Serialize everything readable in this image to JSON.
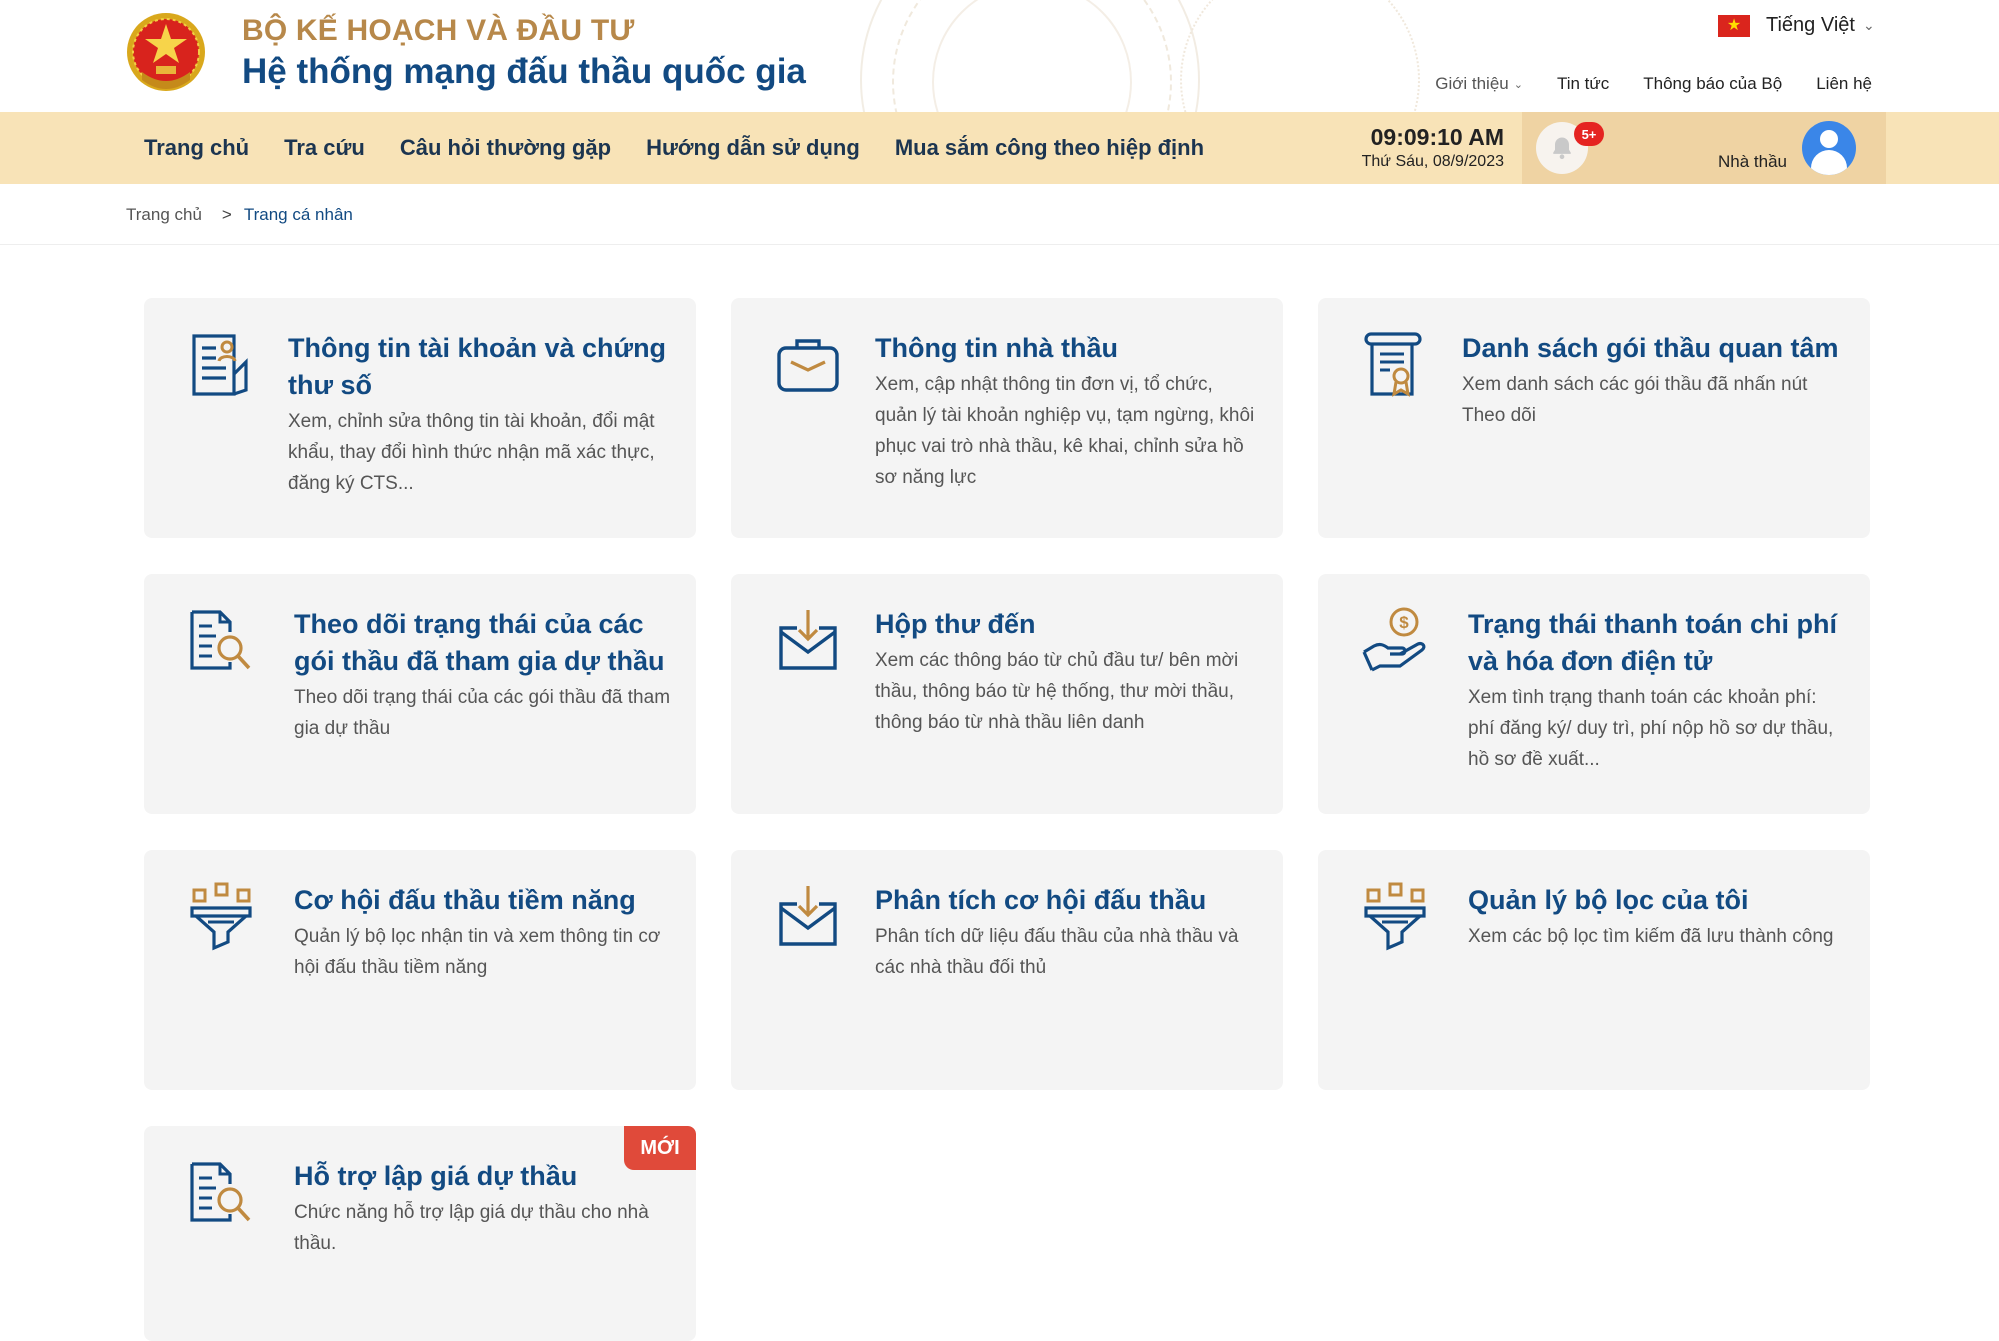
{
  "header": {
    "org_name": "BỘ KẾ HOẠCH VÀ ĐẦU TƯ",
    "system_name": "Hệ thống mạng đấu thầu quốc gia",
    "language": "Tiếng Việt",
    "top_links": [
      {
        "label": "Giới thiệu"
      },
      {
        "label": "Tin tức"
      },
      {
        "label": "Thông báo của Bộ"
      },
      {
        "label": "Liên hệ"
      }
    ]
  },
  "nav": {
    "items": [
      {
        "label": "Trang chủ"
      },
      {
        "label": "Tra cứu"
      },
      {
        "label": "Câu hỏi thường gặp"
      },
      {
        "label": "Hướng dẫn sử dụng"
      },
      {
        "label": "Mua sắm công theo hiệp định"
      }
    ],
    "time": "09:09:10 AM",
    "date": "Thứ Sáu, 08/9/2023",
    "notification_badge": "5+",
    "role": "Nhà thầu"
  },
  "breadcrumb": {
    "home": "Trang chủ",
    "separator": ">",
    "current": "Trang cá nhân"
  },
  "cards": [
    {
      "icon": "account-document-icon",
      "title": "Thông tin tài khoản và chứng thư số",
      "desc": "Xem, chỉnh sửa thông tin tài khoản, đổi mật khẩu, thay đổi hình thức nhận mã xác thực, đăng ký CTS..."
    },
    {
      "icon": "briefcase-icon",
      "title": "Thông tin nhà thầu",
      "desc": "Xem, cập nhật thông tin đơn vị, tổ chức, quản lý tài khoản nghiệp vụ, tạm ngừng, khôi phục vai trò nhà thầu, kê khai, chỉnh sửa hồ sơ năng lực"
    },
    {
      "icon": "certificate-scroll-icon",
      "title": "Danh sách gói thầu quan tâm",
      "desc": "Xem danh sách các gói thầu đã nhấn nút Theo dõi"
    },
    {
      "icon": "document-search-icon",
      "title": "Theo dõi trạng thái của các gói thầu đã tham gia dự thầu",
      "desc": "Theo dõi trạng thái của các gói thầu đã tham gia dự thầu"
    },
    {
      "icon": "inbox-download-icon",
      "title": "Hộp thư đến",
      "desc": "Xem các thông báo từ chủ đầu tư/ bên mời thầu, thông báo từ hệ thống, thư mời thầu, thông báo từ nhà thầu liên danh"
    },
    {
      "icon": "payment-hand-icon",
      "title": "Trạng thái thanh toán chi phí và hóa đơn điện tử",
      "desc": "Xem tình trạng thanh toán các khoản phí: phí đăng ký/ duy trì, phí nộp hồ sơ dự thầu, hồ sơ đề xuất..."
    },
    {
      "icon": "filter-funnel-icon",
      "title": "Cơ hội đấu thầu tiềm năng",
      "desc": "Quản lý bộ lọc nhận tin và xem thông tin cơ hội đấu thầu tiềm năng"
    },
    {
      "icon": "inbox-download-icon",
      "title": "Phân tích cơ hội đấu thầu",
      "desc": "Phân tích dữ liệu đấu thầu của nhà thầu và các nhà thầu đối thủ"
    },
    {
      "icon": "filter-funnel-icon",
      "title": "Quản lý bộ lọc của tôi",
      "desc": "Xem các bộ lọc tìm kiếm đã lưu thành công"
    },
    {
      "icon": "document-search-icon",
      "title": "Hỗ trợ lập giá dự thầu",
      "desc": "Chức năng hỗ trợ lập giá dự thầu cho nhà thầu.",
      "badge": "MỚI"
    }
  ],
  "colors": {
    "primary": "#124a82",
    "gold": "#b7884a",
    "nav_bg": "#f8e3b7",
    "card_bg": "#f4f4f4",
    "badge_red": "#e52421"
  }
}
